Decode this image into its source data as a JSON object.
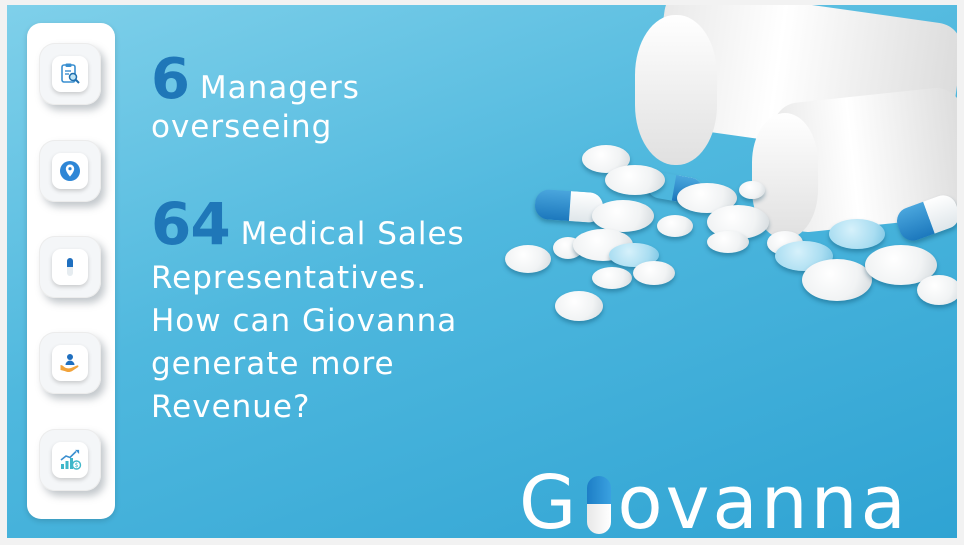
{
  "slide": {
    "headline_1": {
      "number": "6",
      "text_a": "Managers",
      "text_b": "overseeing"
    },
    "headline_2": {
      "number": "64",
      "lines": [
        "Medical Sales",
        "Representatives.",
        "How can Giovanna",
        "generate more",
        "Revenue?"
      ]
    },
    "logo": {
      "part_1": "G",
      "part_2": "ovanna",
      "accent": "#1f77b8"
    }
  },
  "sidebar": {
    "items": [
      {
        "icon": "clipboard-search-icon"
      },
      {
        "icon": "location-pin-icon"
      },
      {
        "icon": "capsule-icon"
      },
      {
        "icon": "hand-person-icon"
      },
      {
        "icon": "growth-chart-icon"
      }
    ]
  },
  "colors": {
    "background": "#4fb8de",
    "number_accent": "#1f77b8",
    "text": "#ffffff"
  }
}
